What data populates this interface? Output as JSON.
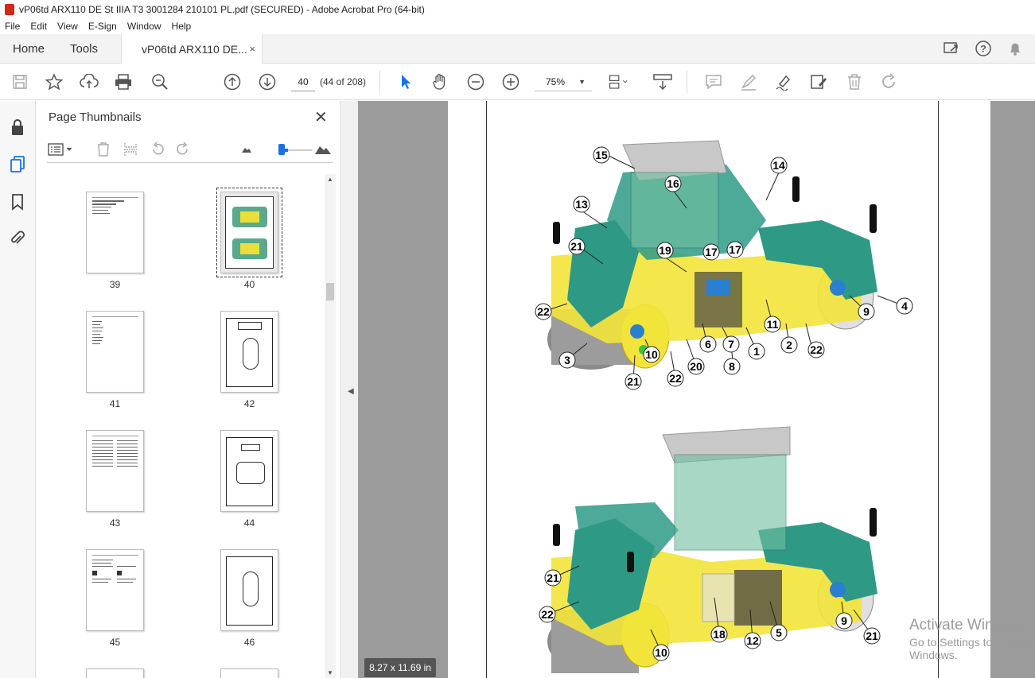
{
  "window": {
    "title": "vP06td ARX110 DE St IIIA T3 3001284 210101 PL.pdf (SECURED) - Adobe Acrobat Pro (64-bit)"
  },
  "menu": [
    "File",
    "Edit",
    "View",
    "E-Sign",
    "Window",
    "Help"
  ],
  "tabs": {
    "home": "Home",
    "tools": "Tools",
    "doc": "vP06td ARX110 DE...",
    "close": "×"
  },
  "toolbar": {
    "page_number": "40",
    "page_count": "(44 of 208)",
    "zoom": "75%"
  },
  "thumbnail_panel": {
    "title": "Page Thumbnails",
    "close": "✕",
    "pages": [
      {
        "label": "39"
      },
      {
        "label": "40"
      },
      {
        "label": "41"
      },
      {
        "label": "42"
      },
      {
        "label": "43"
      },
      {
        "label": "44"
      },
      {
        "label": "45"
      },
      {
        "label": "46"
      }
    ]
  },
  "document": {
    "page_size": "8.27 x 11.69 in",
    "callouts_top": [
      "15",
      "14",
      "16",
      "13",
      "21",
      "19",
      "17",
      "17",
      "4",
      "9",
      "22",
      "11",
      "2",
      "22",
      "6",
      "7",
      "1",
      "3",
      "10",
      "20",
      "8",
      "21",
      "22"
    ],
    "callouts_bottom": [
      "21",
      "22",
      "18",
      "12",
      "5",
      "9",
      "21",
      "10"
    ]
  },
  "watermark": {
    "line1": "Activate Windows",
    "line2": "Go to Settings to activate Windows."
  },
  "colors": {
    "accent": "#1473e6",
    "machine_green": "#2e9a86",
    "machine_yellow": "#f2e43a",
    "doc_bg": "#9b9b9b"
  }
}
